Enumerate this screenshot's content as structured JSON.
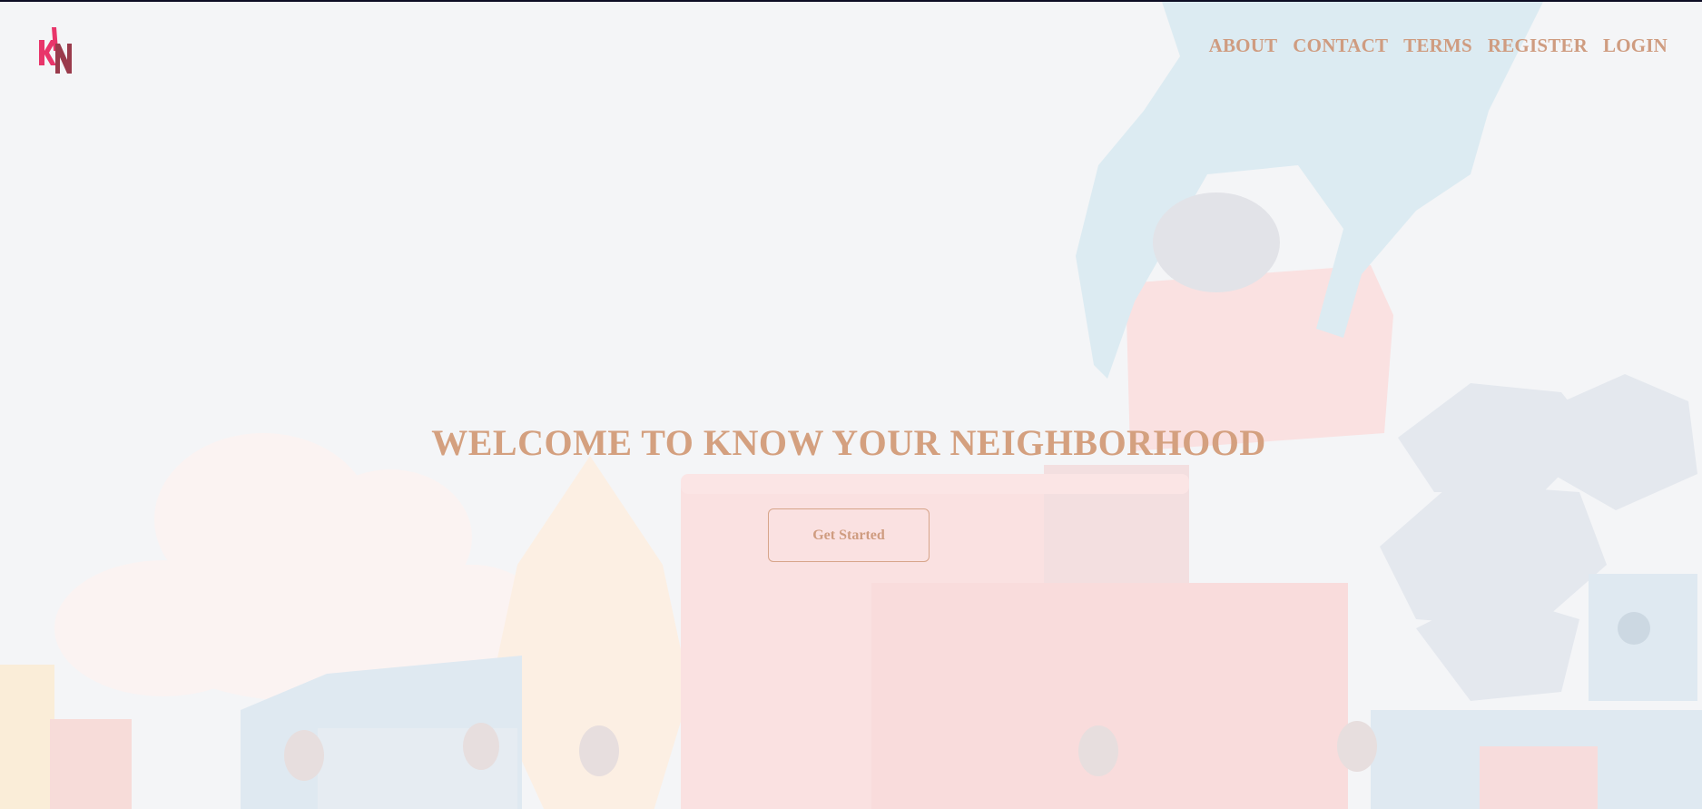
{
  "brand": {
    "logo_name": "kyn-logo"
  },
  "nav": {
    "items": [
      {
        "label": "ABOUT"
      },
      {
        "label": "CONTACT"
      },
      {
        "label": "TERMS"
      },
      {
        "label": "REGISTER"
      },
      {
        "label": "LOGIN"
      }
    ]
  },
  "hero": {
    "title": "WELCOME TO KNOW YOUR NEIGHBORHOOD",
    "cta_label": "Get Started"
  },
  "colors": {
    "background": "#f4f5f7",
    "accent_text": "#cf9c80",
    "logo_pink": "#e8356a",
    "logo_maroon": "#9a3b4c"
  }
}
